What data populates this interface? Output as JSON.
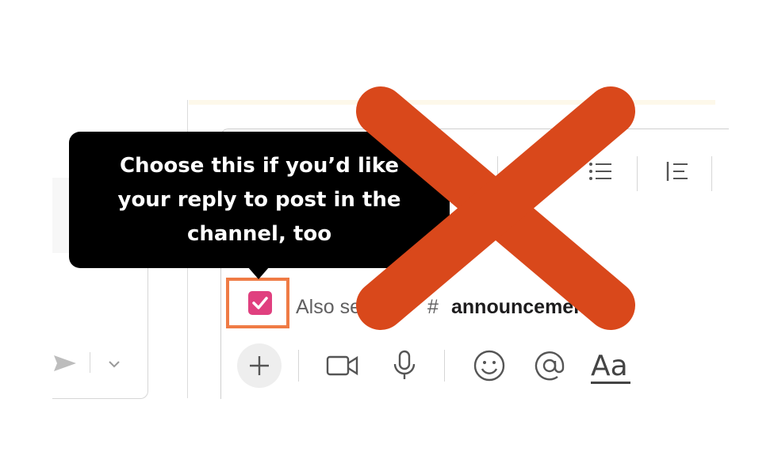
{
  "tooltip": {
    "text": "Choose this if you’d like your reply to post in the channel, too"
  },
  "broadcast": {
    "label": "Also send to",
    "hash": "#",
    "channel": "announcements",
    "checked": true
  },
  "formatting_toolbar": {
    "items": [
      "link-icon",
      "numbered-list-icon",
      "bulleted-list-icon",
      "blockquote-icon"
    ]
  },
  "actions": {
    "items": [
      "plus-icon",
      "video-icon",
      "microphone-icon",
      "emoji-icon",
      "mention-icon",
      "text-format-icon"
    ],
    "text_format_label": "Aa"
  },
  "colors": {
    "checkbox": "#e0407f",
    "highlight_border": "#ef7b45",
    "cross": "#d9481b",
    "tooltip_bg": "#000000"
  }
}
